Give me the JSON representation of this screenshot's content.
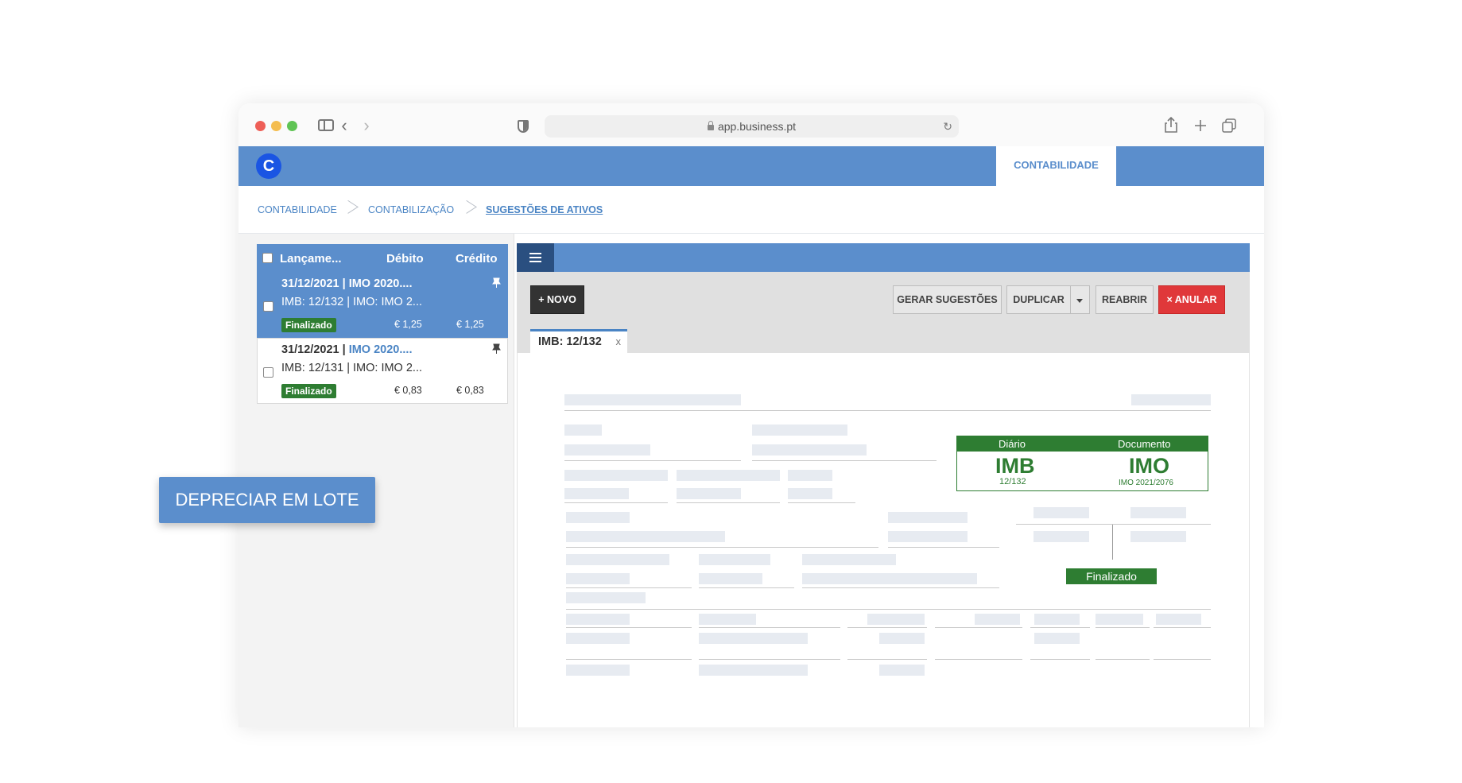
{
  "browser": {
    "url": "app.business.pt"
  },
  "app": {
    "logo_letter": "C",
    "module_tab": "CONTABILIDADE"
  },
  "breadcrumb": {
    "items": [
      "CONTABILIDADE",
      "CONTABILIZAÇÃO",
      "SUGESTÕES DE ATIVOS"
    ]
  },
  "list": {
    "columns": [
      "Lançame...",
      "Débito",
      "Crédito"
    ],
    "rows": [
      {
        "date": "31/12/2021",
        "sep": " | ",
        "ref": "IMO 2020....",
        "line2": "IMB: 12/132 | IMO: IMO 2...",
        "status": "Finalizado",
        "debit": "€ 1,25",
        "credit": "€ 1,25",
        "selected": true
      },
      {
        "date": "31/12/2021",
        "sep": " | ",
        "ref": "IMO 2020....",
        "line2": "IMB: 12/131 | IMO: IMO 2...",
        "status": "Finalizado",
        "debit": "€ 0,83",
        "credit": "€ 0,83",
        "selected": false
      }
    ]
  },
  "toolbar": {
    "new_label": "+ NOVO",
    "gerar_label": "GERAR SUGESTÕES",
    "duplicar_label": "DUPLICAR",
    "reabrir_label": "REABRIR",
    "anular_label": "× ANULAR"
  },
  "doc_tab": {
    "label": "IMB: 12/132",
    "close": "x"
  },
  "document": {
    "diario_header": "Diário",
    "documento_header": "Documento",
    "diario_value": "IMB",
    "diario_sub": "12/132",
    "documento_value": "IMO",
    "documento_sub": "IMO 2021/2076",
    "status": "Finalizado"
  },
  "bulk_button": "DEPRECIAR EM LOTE",
  "colors": {
    "primary": "#5b8ecc",
    "dark_navy": "#2a4f80",
    "success": "#2e7d32",
    "danger": "#e0383a"
  }
}
